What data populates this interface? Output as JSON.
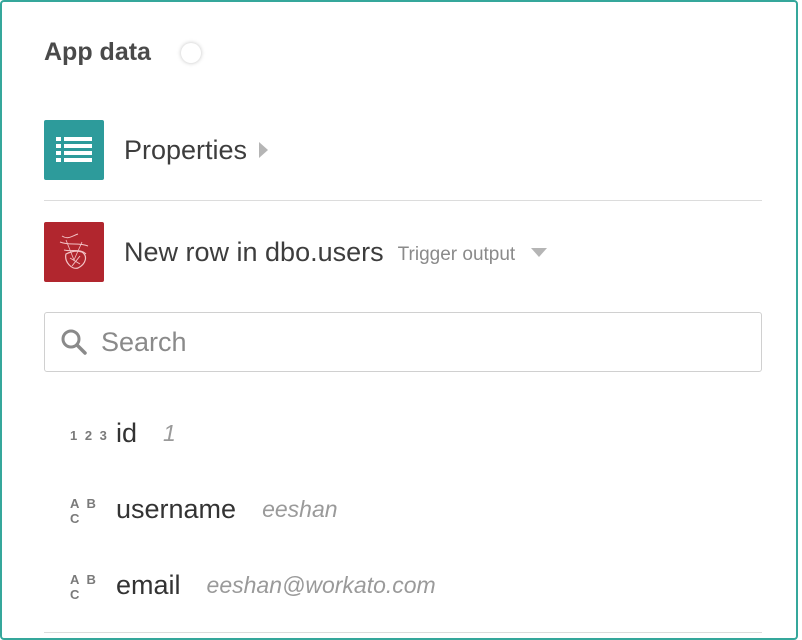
{
  "header": {
    "title": "App data"
  },
  "properties": {
    "label": "Properties",
    "icon": "list-icon",
    "color": "#2d9b9b"
  },
  "trigger": {
    "label": "New row in dbo.users",
    "sub_label": "Trigger output",
    "icon": "sql-server-icon",
    "color": "#b1262e"
  },
  "search": {
    "placeholder": "Search"
  },
  "fields": [
    {
      "type": "1 2 3",
      "name": "id",
      "value": "1"
    },
    {
      "type": "A B C",
      "name": "username",
      "value": "eeshan"
    },
    {
      "type": "A B C",
      "name": "email",
      "value": "eeshan@workato.com"
    }
  ]
}
